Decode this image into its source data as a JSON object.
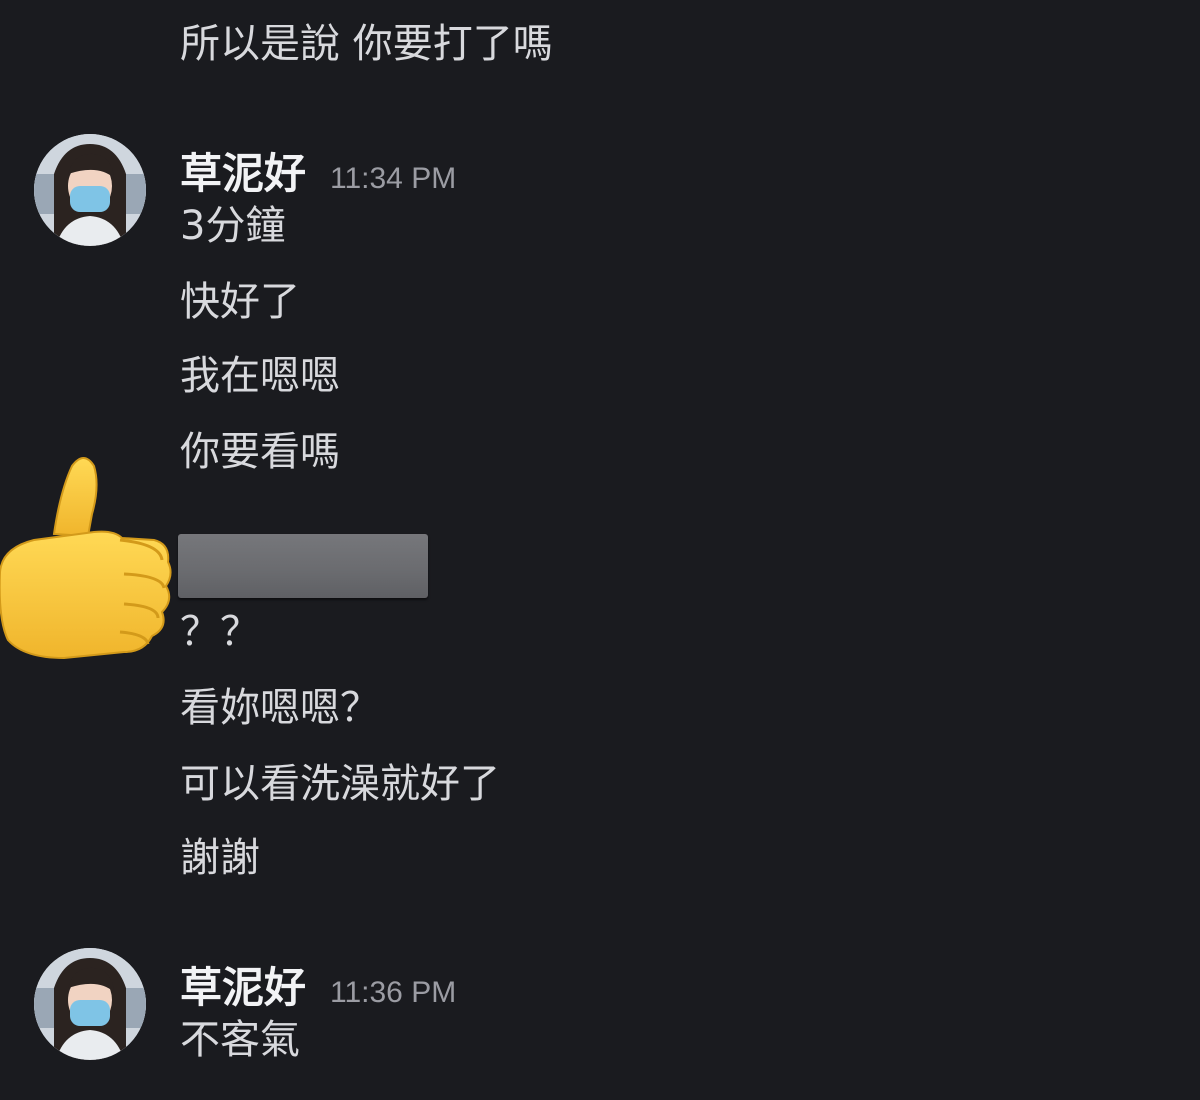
{
  "messages": {
    "previous_tail": "所以是說 你要打了嗎",
    "group1": {
      "author": "草泥好",
      "time": "11:34 PM",
      "lines": [
        "3分鐘",
        "快好了",
        "我在嗯嗯",
        "你要看嗎"
      ]
    },
    "reply_group": {
      "lines": [
        "？？",
        "看妳嗯嗯？",
        "可以看洗澡就好了",
        "謝謝"
      ]
    },
    "group2": {
      "author": "草泥好",
      "time": "11:36 PM",
      "lines": [
        "不客氣"
      ]
    }
  },
  "icons": {
    "reaction": "thumbs-up-icon",
    "avatar": "user-avatar"
  },
  "colors": {
    "background": "#1a1b1f",
    "text": "#d8d9dd",
    "author": "#f2f3f5",
    "timestamp": "#9b9ca3",
    "redaction": "#6c6d71",
    "thumb": "#f7c63a"
  }
}
